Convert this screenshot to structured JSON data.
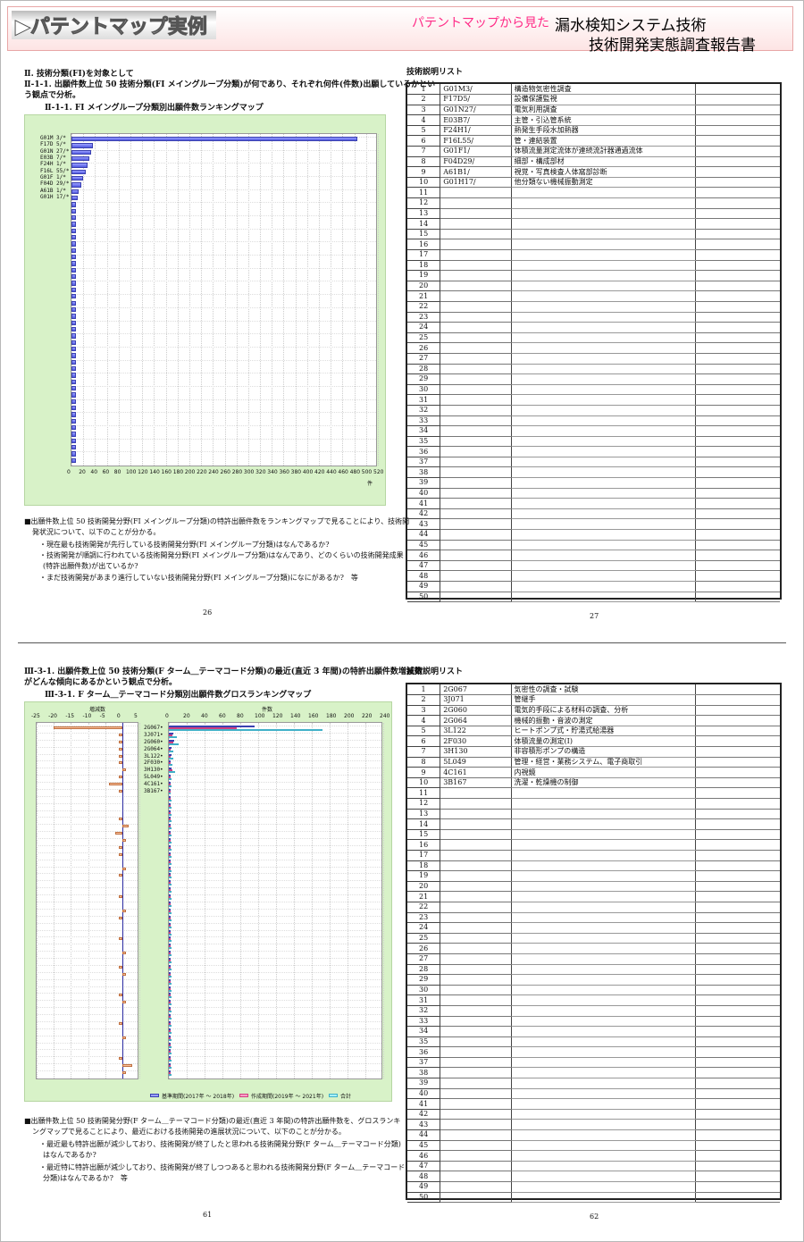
{
  "header": {
    "left_title": "▶パテントマップ実例",
    "tag": "パテントマップから見た",
    "title": "漏水検知システム技術",
    "subtitle": "技術開発実態調査報告書"
  },
  "top": {
    "section": "Ⅱ. 技術分類(FI)を対象として",
    "q1": "Ⅱ-1-1. 出願件数上位 50 技術分類(FI メイングループ分類)が何であり、それぞれ何件(件数)出願しているかとい",
    "q2": "う観点で分析。",
    "map_title": "Ⅱ-1-1. FI メイングループ分類別出願件数ランキングマップ",
    "unit": "件",
    "note1": "■出願件数上位 50 技術開発分野(FI メイングループ分類)の特許出願件数をランキングマップで見ることにより、技術開",
    "note2": "発状況について、以下のことが分かる。",
    "b1": "・現在最も技術開発が先行している技術開発分野(FI メイングループ分類)はなんであるか?",
    "b2": "・技術開発が順調に行われている技術開発分野(FI メイングループ分類)はなんであり、どのくらいの技術開発成果",
    "b2b": "(特許出願件数)が出ているか?",
    "b3": "・まだ技術開発があまり進行していない技術開発分野(FI メイングループ分類)になにがあるか?　等",
    "page_left": "26",
    "page_right": "27",
    "list_title": "技術説明リスト"
  },
  "chart_data": [
    {
      "type": "bar",
      "title": "Ⅱ-1-1. FI メイングループ分類別出願件数ランキングマップ",
      "xlabel": "件",
      "xlim": [
        0,
        520
      ],
      "categories": [
        "G01M 3/",
        "F17D 5/",
        "G01N 27/",
        "E03B 7/",
        "F24H 1/",
        "F16L 55/",
        "G01F 1/",
        "F04D 29/",
        "A61B 1/",
        "G01H 17/"
      ],
      "labels": [
        "G01M  3/*",
        "F17D  5/*",
        "G01N 27/*",
        "E03B  7/*",
        "F24H  1/*",
        "F16L 55/*",
        "G01F  1/*",
        "F04D 29/*",
        "A61B  1/*",
        "G01H 17/*"
      ],
      "values": [
        485,
        36,
        34,
        30,
        28,
        25,
        20,
        16,
        12,
        10
      ],
      "rest_count": 40,
      "rest_value": 8,
      "ticks": [
        "0",
        "20",
        "40",
        "60",
        "80",
        "100",
        "120",
        "140",
        "160",
        "180",
        "200",
        "220",
        "240",
        "260",
        "280",
        "300",
        "320",
        "340",
        "360",
        "380",
        "400",
        "420",
        "440",
        "460",
        "480",
        "500",
        "520"
      ]
    },
    {
      "type": "bar",
      "title": "Ⅲ-3-1. F ターム＿テーマコード分類別出願件数グロスランキングマップ",
      "left_axis_label": "増減数",
      "right_axis_label": "件数",
      "categories": [
        "2G067",
        "3J071",
        "2G060",
        "2G064",
        "3L122",
        "2F030",
        "3H130",
        "5L049",
        "4C161",
        "3B167"
      ],
      "labels": [
        "2G067•",
        "3J071•",
        "2G060•",
        "2G064•",
        "3L122•",
        "2F030•",
        "3H130•",
        "5L049•",
        "4C161•",
        "3B167•"
      ],
      "increase": [
        -20,
        -1,
        -1,
        -1,
        -1,
        -1,
        1,
        -1,
        -4,
        -1
      ],
      "series": [
        {
          "name": "基準期間(2017年 ～ 2018年)",
          "values": [
            96,
            5,
            6,
            3,
            3,
            2,
            3,
            2,
            2,
            1
          ]
        },
        {
          "name": "作成期間(2019年 ～ 2021年)",
          "values": [
            76,
            4,
            5,
            2,
            2,
            2,
            4,
            1,
            1,
            1
          ]
        },
        {
          "name": "合計",
          "values": [
            172,
            9,
            11,
            5,
            5,
            4,
            7,
            3,
            3,
            2
          ]
        }
      ],
      "left_ticks": [
        "-25",
        "-20",
        "-15",
        "-10",
        "-5",
        "0",
        "5"
      ],
      "right_ticks": [
        "0",
        "20",
        "40",
        "60",
        "80",
        "100",
        "120",
        "140",
        "160",
        "180",
        "200",
        "220",
        "240"
      ]
    }
  ],
  "list1": [
    {
      "n": "1",
      "code": "G01M3/",
      "desc": "構造物気密性調査"
    },
    {
      "n": "2",
      "code": "F17D5/",
      "desc": "設備保護監視"
    },
    {
      "n": "3",
      "code": "G01N27/",
      "desc": "電気利用調査"
    },
    {
      "n": "4",
      "code": "E03B7/",
      "desc": "主管・引込管系統"
    },
    {
      "n": "5",
      "code": "F24H1/",
      "desc": "熱発生手段水加熱器"
    },
    {
      "n": "6",
      "code": "F16L55/",
      "desc": "管・連結装置"
    },
    {
      "n": "7",
      "code": "G01F1/",
      "desc": "体積流量測定流体が連続流計器通過流体"
    },
    {
      "n": "8",
      "code": "F04D29/",
      "desc": "細部・構成部材"
    },
    {
      "n": "9",
      "code": "A61B1/",
      "desc": "視覚・写真検査人体窩部診断"
    },
    {
      "n": "10",
      "code": "G01H17/",
      "desc": "他分類ない機械振動測定"
    }
  ],
  "bottom": {
    "q1": "Ⅲ-3-1. 出願件数上位 50 技術分類(F ターム＿テーマコード分類)の最近(直近 3 年間)の特許出願件数増減数",
    "q2": "がどんな傾向にあるかという観点で分析。",
    "map_title": "Ⅲ-3-1. F ターム＿テーマコード分類別出願件数グロスランキングマップ",
    "legend_base": "基準期間(2017年 ～ 2018年)",
    "legend_make": "作成期間(2019年 ～ 2021年)",
    "legend_total": "合計",
    "note1": "■出願件数上位 50 技術開発分野(F ターム＿テーマコード分類)の最近(直近 3 年間)の特許出願件数を、グロスランキ",
    "note2": "ングマップで見ることにより、最近における技術開発の進展状況について、以下のことが分かる。",
    "b1": "・最近最も特許出願が減少しており、技術開発が終了したと思われる技術開発分野(F ターム＿テーマコード分類)",
    "b1b": "はなんであるか?",
    "b2": "・最近特に特許出願が減少しており、技術開発が終了しつつあると思われる技術開発分野(F ターム＿テーマコード",
    "b2b": "分類)はなんであるか?　等",
    "page_left": "61",
    "page_right": "62",
    "list_title": "技術説明リスト"
  },
  "list2": [
    {
      "n": "1",
      "code": "2G067",
      "desc": "気密性の調査・試験"
    },
    {
      "n": "2",
      "code": "3J071",
      "desc": "管継手"
    },
    {
      "n": "3",
      "code": "2G060",
      "desc": "電気的手段による材料の調査、分析"
    },
    {
      "n": "4",
      "code": "2G064",
      "desc": "機械的振動・音波の測定"
    },
    {
      "n": "5",
      "code": "3L122",
      "desc": "ヒートポンプ式・貯湯式給湯器"
    },
    {
      "n": "6",
      "code": "2F030",
      "desc": "体積流量の測定(I)"
    },
    {
      "n": "7",
      "code": "3H130",
      "desc": "非容積形ポンプの構造"
    },
    {
      "n": "8",
      "code": "5L049",
      "desc": "管理・経営・業務システム、電子商取引"
    },
    {
      "n": "9",
      "code": "4C161",
      "desc": "内視鏡"
    },
    {
      "n": "10",
      "code": "3B167",
      "desc": "洗濯・乾燥機の制御"
    }
  ]
}
